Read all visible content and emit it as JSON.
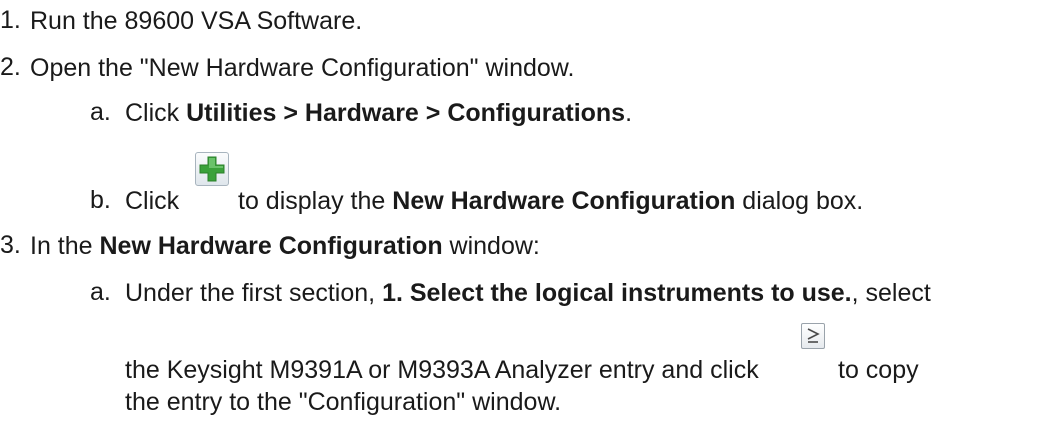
{
  "steps": [
    {
      "num": "1.",
      "text": "Run the 89600 VSA Software."
    },
    {
      "num": "2.",
      "text": "Open the \"New Hardware Configuration\" window.",
      "substeps": [
        {
          "num": "a.",
          "pre": "Click ",
          "bold": "Utilities > Hardware > Configurations",
          "post": "."
        },
        {
          "num": "b.",
          "pre": "Click ",
          "mid": "to display the ",
          "bold": "New Hardware Configuration",
          "post": " dialog box."
        }
      ]
    },
    {
      "num": "3.",
      "pre": "In the ",
      "bold": "New Hardware Configuration",
      "post": " window:",
      "substeps": [
        {
          "num": "a.",
          "pre": "Under the first section, ",
          "bold": "1. Select the logical instruments to use.",
          "post": ", select",
          "line2_pre": "the Keysight M9391A or M9393A Analyzer entry and click ",
          "line2_post": "to copy",
          "line3": "the entry to the \"Configuration\" window."
        }
      ]
    }
  ],
  "icons": {
    "add": "add-plus-icon",
    "copy": "copy-right-arrow-icon"
  },
  "colors": {
    "plus_green": "#3aa13a",
    "text": "#1a1a1a"
  }
}
